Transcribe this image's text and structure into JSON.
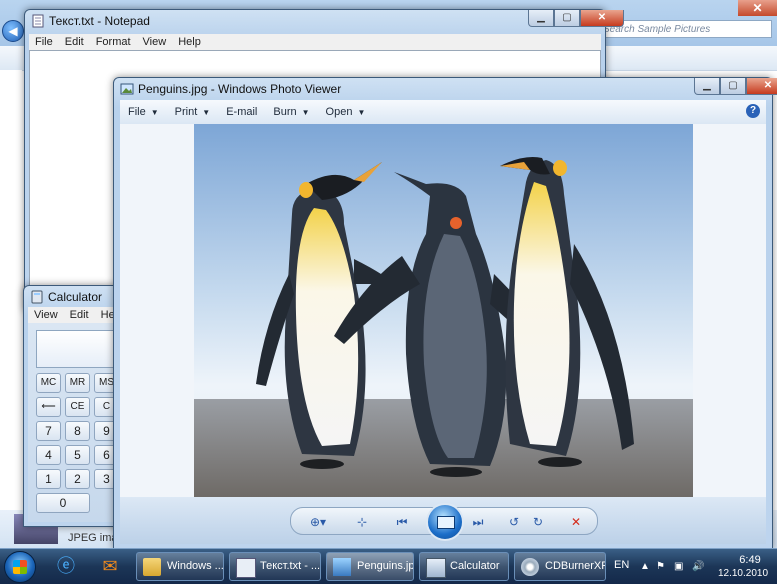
{
  "explorer": {
    "search_placeholder": "Search Sample Pictures",
    "details_label": "JPEG imag"
  },
  "notepad": {
    "title": "Текст.txt - Notepad",
    "menu": [
      "File",
      "Edit",
      "Format",
      "View",
      "Help"
    ]
  },
  "calculator": {
    "title": "Calculator",
    "menu": [
      "View",
      "Edit",
      "Help"
    ],
    "keys": {
      "mc": "MC",
      "mr": "MR",
      "ms": "MS",
      "back": "⟵",
      "ce": "CE",
      "c": "C",
      "k7": "7",
      "k8": "8",
      "k9": "9",
      "k4": "4",
      "k5": "5",
      "k6": "6",
      "k1": "1",
      "k2": "2",
      "k3": "3",
      "k0": "0"
    }
  },
  "photo_viewer": {
    "title": "Penguins.jpg - Windows Photo Viewer",
    "menu": {
      "file": "File",
      "print": "Print",
      "email": "E-mail",
      "burn": "Burn",
      "open": "Open"
    },
    "help": "?"
  },
  "taskbar": {
    "buttons": {
      "explorer": "Windows ...",
      "notepad": "Текст.txt - ...",
      "photo": "Penguins.jp...",
      "calc": "Calculator",
      "cdburner": "CDBurnerXP"
    },
    "lang": "EN",
    "time": "6:49",
    "date": "12.10.2010"
  }
}
